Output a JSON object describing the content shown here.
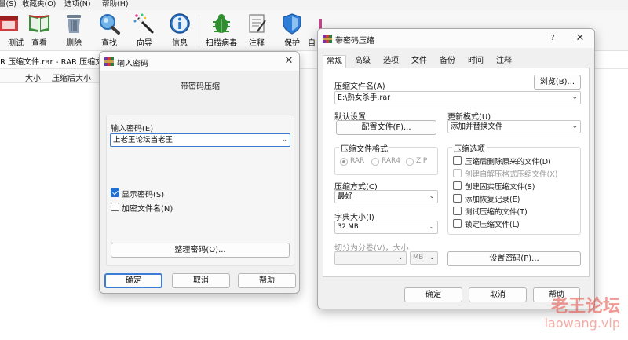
{
  "main_window": {
    "menu": [
      "量(S)",
      "收藏夹(O)",
      "选项(N)",
      "帮助(H)"
    ],
    "toolbar": [
      {
        "label": "测试",
        "icon": "test-icon"
      },
      {
        "label": "查看",
        "icon": "view-book-icon"
      },
      {
        "label": "删除",
        "icon": "trash-icon"
      },
      {
        "label": "查找",
        "icon": "magnifier-icon"
      },
      {
        "label": "向导",
        "icon": "wand-icon"
      },
      {
        "label": "信息",
        "icon": "info-icon"
      },
      {
        "label": "扫描病毒",
        "icon": "bug-icon"
      },
      {
        "label": "注释",
        "icon": "note-icon"
      },
      {
        "label": "保护",
        "icon": "shield-icon"
      },
      {
        "label": "自",
        "icon": "sfx-icon"
      }
    ],
    "address_text": "R 压缩文件.rar - RAR 压缩文",
    "columns": [
      "大小",
      "压缩后大小"
    ]
  },
  "compress_dialog": {
    "title": "带密码压缩",
    "tabs": [
      "常规",
      "高级",
      "选项",
      "文件",
      "备份",
      "时间",
      "注释"
    ],
    "archive_name_label": "压缩文件名(A)",
    "browse_button": "浏览(B)...",
    "archive_name_value": "E:\\熟女杀手.rar",
    "default_settings_label": "默认设置",
    "profiles_button": "配置文件(F)...",
    "update_mode_label": "更新模式(U)",
    "update_mode_value": "添加并替换文件",
    "format_group_label": "压缩文件格式",
    "formats": [
      "RAR",
      "RAR4",
      "ZIP"
    ],
    "options_group_label": "压缩选项",
    "options": [
      {
        "label": "压缩后删除原来的文件(D)",
        "checked": false,
        "disabled": false
      },
      {
        "label": "创建自解压格式压缩文件(X)",
        "checked": false,
        "disabled": true
      },
      {
        "label": "创建固实压缩文件(S)",
        "checked": false,
        "disabled": false
      },
      {
        "label": "添加恢复记录(E)",
        "checked": false,
        "disabled": false
      },
      {
        "label": "测试压缩的文件(T)",
        "checked": false,
        "disabled": false
      },
      {
        "label": "锁定压缩文件(L)",
        "checked": false,
        "disabled": false
      }
    ],
    "method_label": "压缩方式(C)",
    "method_value": "最好",
    "dict_label": "字典大小(I)",
    "dict_value": "32 MB",
    "split_label": "切分为分卷(V)，大小",
    "split_unit": "MB",
    "set_password_button": "设置密码(P)...",
    "ok": "确定",
    "cancel": "取消",
    "help": "帮助",
    "help_glyph": "?",
    "close_glyph": "✕"
  },
  "password_dialog": {
    "title": "输入密码",
    "heading": "带密码压缩",
    "input_label": "输入密码(E)",
    "password_value": "上老王论坛当老王",
    "show_password": "显示密码(S)",
    "show_password_checked": true,
    "encrypt_names": "加密文件名(N)",
    "encrypt_names_checked": false,
    "organize_button": "整理密码(O)...",
    "ok": "确定",
    "cancel": "取消",
    "help": "帮助",
    "close_glyph": "✕"
  },
  "watermark": {
    "line1": "老王论坛",
    "line2": "laowang.vip"
  }
}
